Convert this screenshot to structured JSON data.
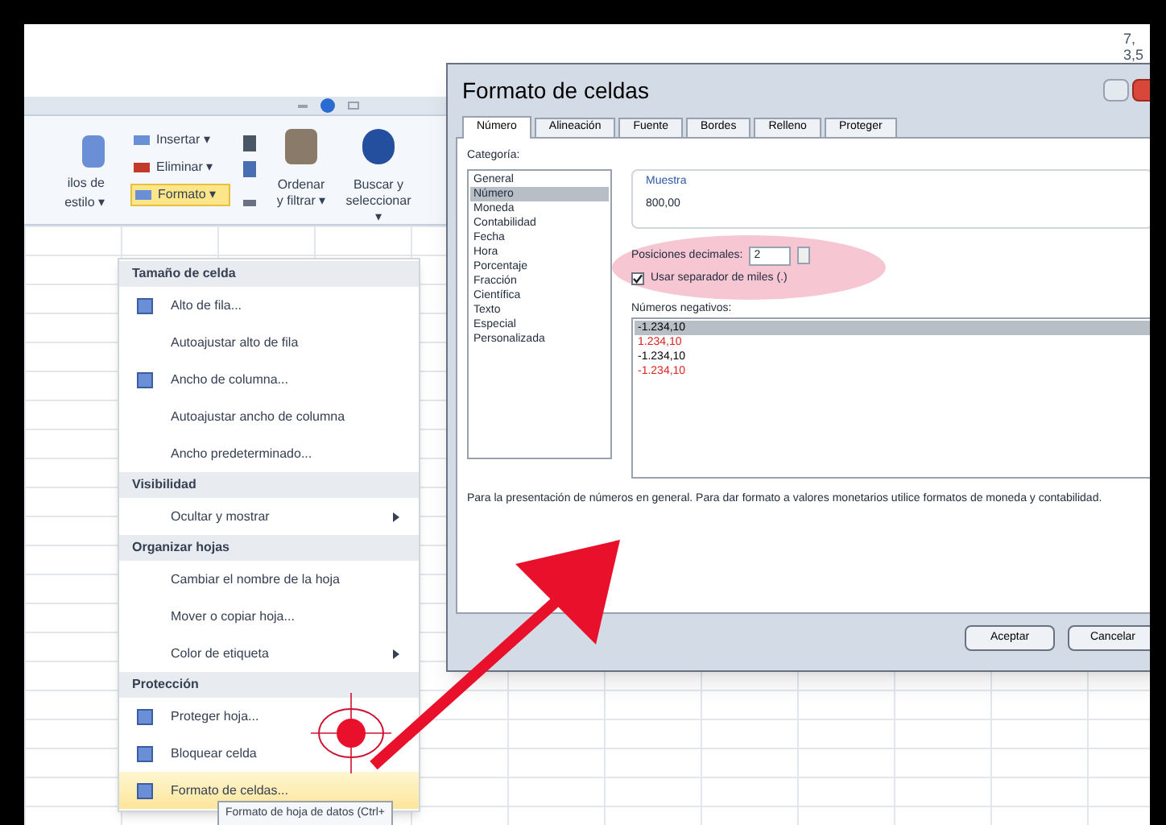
{
  "corner_text": [
    "7,",
    "3,5"
  ],
  "ribbon": {
    "cut_label": [
      "ilos de",
      "estilo ▾"
    ],
    "cells_group": [
      {
        "label": "Insertar ▾",
        "selected": false
      },
      {
        "label": "Eliminar ▾",
        "selected": false
      },
      {
        "label": "Formato ▾",
        "selected": true
      }
    ],
    "edit_group": [
      {
        "label": "Ordenar",
        "label2": "y filtrar ▾"
      },
      {
        "label": "Buscar y",
        "label2": "seleccionar ▾"
      }
    ]
  },
  "menu": [
    {
      "kind": "header",
      "label": "Tamaño de celda"
    },
    {
      "kind": "item",
      "label": "Alto de fila...",
      "icon": true,
      "selected": false
    },
    {
      "kind": "item",
      "label": "Autoajustar alto de fila",
      "icon": false,
      "selected": false
    },
    {
      "kind": "item",
      "label": "Ancho de columna...",
      "icon": true,
      "selected": false
    },
    {
      "kind": "item",
      "label": "Autoajustar ancho de columna",
      "icon": false,
      "selected": false
    },
    {
      "kind": "item",
      "label": "Ancho predeterminado...",
      "icon": false,
      "selected": false
    },
    {
      "kind": "header",
      "label": "Visibilidad"
    },
    {
      "kind": "submenu",
      "label": "Ocultar y mostrar",
      "icon": false,
      "selected": false
    },
    {
      "kind": "header",
      "label": "Organizar hojas"
    },
    {
      "kind": "item",
      "label": "Cambiar el nombre de la hoja",
      "icon": false,
      "selected": false
    },
    {
      "kind": "item",
      "label": "Mover o copiar hoja...",
      "icon": false,
      "selected": false
    },
    {
      "kind": "submenu",
      "label": "Color de etiqueta",
      "icon": false,
      "selected": false
    },
    {
      "kind": "header",
      "label": "Protección"
    },
    {
      "kind": "item",
      "label": "Proteger hoja...",
      "icon": true,
      "selected": false
    },
    {
      "kind": "item",
      "label": "Bloquear celda",
      "icon": true,
      "selected": false
    },
    {
      "kind": "item",
      "label": "Formato de celdas...",
      "icon": true,
      "selected": true
    }
  ],
  "tooltip": "Formato de hoja de datos (Ctrl+",
  "dialog": {
    "title": "Formato de celdas",
    "tabs": [
      {
        "label": "Número",
        "selected": true
      },
      {
        "label": "Alineación",
        "selected": false
      },
      {
        "label": "Fuente",
        "selected": false
      },
      {
        "label": "Bordes",
        "selected": false
      },
      {
        "label": "Relleno",
        "selected": false
      },
      {
        "label": "Proteger",
        "selected": false
      }
    ],
    "category_label": "Categoría:",
    "categories": [
      {
        "label": "General",
        "selected": false
      },
      {
        "label": "Número",
        "selected": true
      },
      {
        "label": "Moneda",
        "selected": false
      },
      {
        "label": "Contabilidad",
        "selected": false
      },
      {
        "label": "Fecha",
        "selected": false
      },
      {
        "label": "Hora",
        "selected": false
      },
      {
        "label": "Porcentaje",
        "selected": false
      },
      {
        "label": "Fracción",
        "selected": false
      },
      {
        "label": "Científica",
        "selected": false
      },
      {
        "label": "Texto",
        "selected": false
      },
      {
        "label": "Especial",
        "selected": false
      },
      {
        "label": "Personalizada",
        "selected": false
      }
    ],
    "sample_label": "Muestra",
    "sample_value": "800,00",
    "decimals_label": "Posiciones decimales:",
    "decimals_value": "2",
    "separator": {
      "label": "Usar separador de miles (.)",
      "checked": true
    },
    "negatives_label": "Números negativos:",
    "negatives": [
      {
        "label": "-1.234,10",
        "color": "#000000",
        "selected": true
      },
      {
        "label": "1.234,10",
        "color": "#e02020",
        "selected": false
      },
      {
        "label": "-1.234,10",
        "color": "#000000",
        "selected": false
      },
      {
        "label": "-1.234,10",
        "color": "#e02020",
        "selected": false
      }
    ],
    "description": "Para la presentación de números en general. Para dar formato a valores monetarios utilice formatos de moneda y contabilidad.",
    "buttons": [
      "Aceptar",
      "Cancelar"
    ]
  }
}
